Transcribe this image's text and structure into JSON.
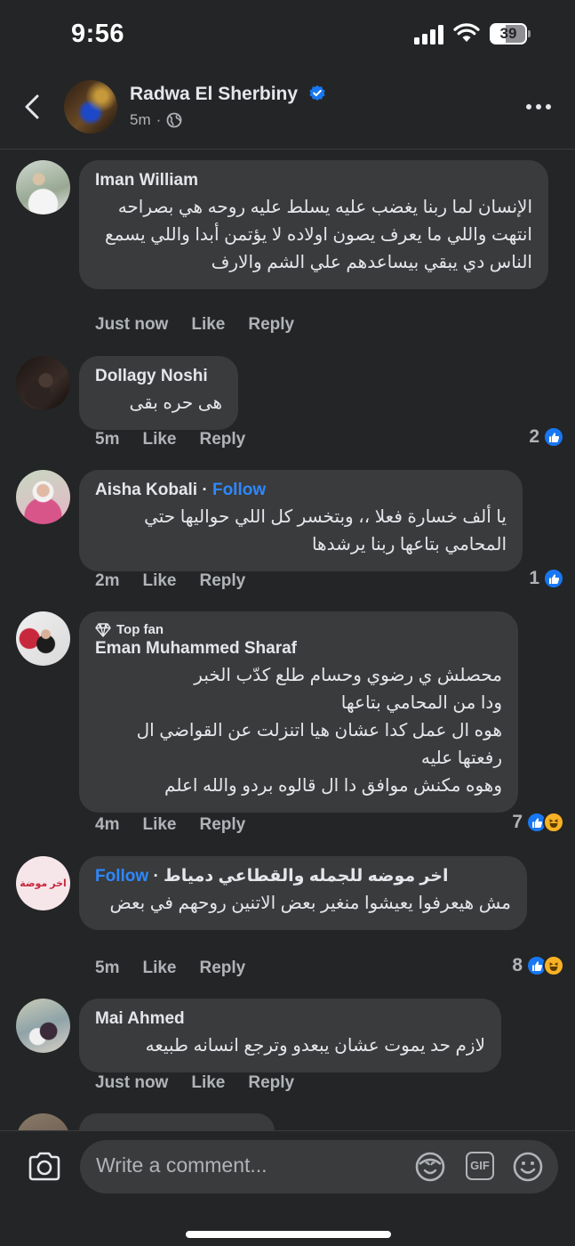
{
  "status": {
    "time": "9:56",
    "battery": "39"
  },
  "header": {
    "name": "Radwa El Sherbiny",
    "time": "5m",
    "separator": "·"
  },
  "comments": [
    {
      "name": "Iman William",
      "text": "الإنسان لما ربنا يغضب عليه يسلط عليه روحه هي بصراحه انتهت واللي ما يعرف يصون اولاده لا يؤتمن أبدا واللي يسمع الناس دي يبقي بيساعدهم علي الشم والارف",
      "time": "Just now",
      "like": "Like",
      "reply": "Reply"
    },
    {
      "name": "Dollagy Noshi",
      "text": "هى حره بقى",
      "time": "5m",
      "like": "Like",
      "reply": "Reply",
      "reaction_count": "2"
    },
    {
      "name": "Aisha Kobali",
      "follow": "Follow",
      "text": "يا ألف خسارة فعلا ،، وبتخسر كل اللي حواليها حتي المحامي بتاعها ربنا يرشدها",
      "time": "2m",
      "like": "Like",
      "reply": "Reply",
      "reaction_count": "1"
    },
    {
      "badge": "Top fan",
      "name": "Eman Muhammed Sharaf",
      "text_lines": [
        "محصلش ي رضوي وحسام طلع كدّب الخبر",
        "ودا من المحامي بتاعها",
        "هوه ال عمل كدا عشان هيا  اتنزلت عن القواضي ال رفعتها عليه",
        "وهوه مكنش موافق دا ال قالوه بردو والله اعلم"
      ],
      "time": "4m",
      "like": "Like",
      "reply": "Reply",
      "reaction_count": "7"
    },
    {
      "name": "اخر موضه للجمله والقطاعي دمياط",
      "follow": "Follow",
      "text": "مش هيعرفوا يعيشوا منغير بعض الاتنين روحهم في بعض",
      "time": "5m",
      "like": "Like",
      "reply": "Reply",
      "reaction_count": "8",
      "avatar_text": "اخر موضة"
    },
    {
      "name": "Mai Ahmed",
      "text": "لازم حد يموت عشان يبعدو وترجع انسانه طبيعه",
      "time": "Just now",
      "like": "Like",
      "reply": "Reply"
    }
  ],
  "composer": {
    "placeholder": "Write a comment...",
    "gif_label": "GIF"
  },
  "icons": {
    "back": "chevron-left-icon",
    "verified": "verified-badge-icon",
    "globe": "globe-icon",
    "more": "more-icon",
    "like": "like-reaction-icon",
    "haha": "haha-reaction-icon",
    "top_fan": "diamond-icon",
    "camera": "camera-icon",
    "avatar_sticker": "avatar-sticker-icon",
    "emoji": "emoji-icon"
  },
  "colors": {
    "background": "#242526",
    "bubble": "#3a3b3c",
    "accent": "#1877f2",
    "follow": "#2d88ff",
    "secondary_text": "#b0b3b8"
  }
}
